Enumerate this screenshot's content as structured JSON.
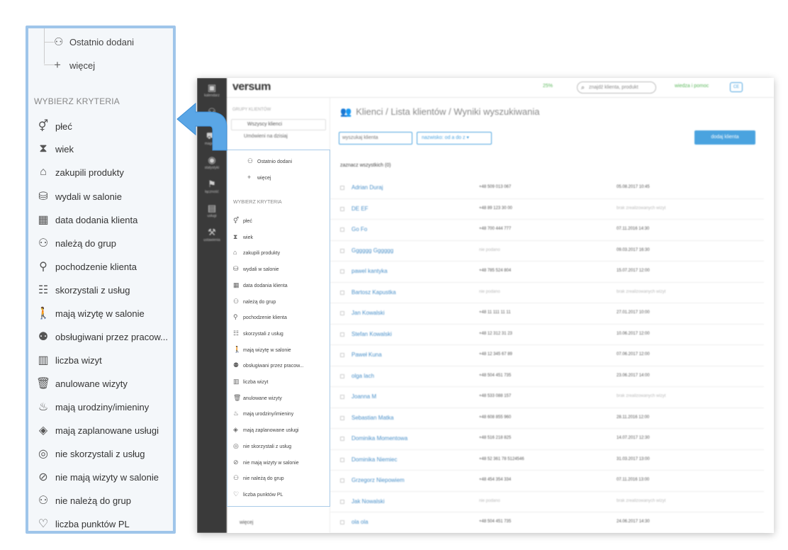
{
  "zoom_panel": {
    "recent_label": "Ostatnio dodani",
    "more_label": "więcej",
    "section_title": "WYBIERZ KRYTERIA",
    "criteria": [
      {
        "label": "płeć",
        "icon": "gender-icon"
      },
      {
        "label": "wiek",
        "icon": "hourglass-icon"
      },
      {
        "label": "zakupili produkty",
        "icon": "shopping-bag-icon"
      },
      {
        "label": "wydali w salonie",
        "icon": "coins-icon"
      },
      {
        "label": "data dodania klienta",
        "icon": "calendar-icon"
      },
      {
        "label": "należą do grup",
        "icon": "user-group-icon"
      },
      {
        "label": "pochodzenie klienta",
        "icon": "origin-icon"
      },
      {
        "label": "skorzystali z usług",
        "icon": "services-list-icon"
      },
      {
        "label": "mają wizytę w salonie",
        "icon": "walking-person-icon"
      },
      {
        "label": "obsługiwani przez pracow...",
        "icon": "employee-icon"
      },
      {
        "label": "liczba wizyt",
        "icon": "bar-chart-icon"
      },
      {
        "label": "anulowane wizyty",
        "icon": "trash-icon"
      },
      {
        "label": "mają urodziny/imieniny",
        "icon": "birthday-cake-icon"
      },
      {
        "label": "mają zaplanowane usługi",
        "icon": "ticket-icon"
      },
      {
        "label": "nie skorzystali z usług",
        "icon": "no-services-icon"
      },
      {
        "label": "nie mają wizyty w salonie",
        "icon": "prohibited-icon"
      },
      {
        "label": "nie należą do grup",
        "icon": "no-group-icon"
      },
      {
        "label": "liczba punktów PL",
        "icon": "heart-icon"
      }
    ]
  },
  "app": {
    "logo": "versum",
    "progress_label": "25%",
    "search_placeholder": "znajdź klienta, produkt",
    "help_label": "wiedza i pomoc",
    "user_label": "CE",
    "rail": [
      "kalendarz",
      "klienci",
      "magazyn",
      "statystyki",
      "łączność",
      "usługi",
      "ustawienia"
    ],
    "groups_title": "GRUPY KLIENTÓW",
    "all_clients": "Wszyscy klienci",
    "today_label": "Umówieni na dzisiaj",
    "recent_label": "Ostatnio dodani",
    "more_label": "więcej",
    "criteria_title": "WYBIERZ KRYTERIA",
    "bottom_more": "więcej",
    "breadcrumb": "Klienci / Lista klientów / Wyniki wyszukiwania",
    "search_client": "wyszukaj klienta",
    "sort_label": "nazwisko: od a do z ▾",
    "add_client": "dodaj klienta",
    "select_all": "zaznacz wszystkich (0)",
    "clients": [
      {
        "name": "Adrian Duraj",
        "phone": "+48 509 013 067",
        "visit": "05.08.2017 10:45"
      },
      {
        "name": "DE EF",
        "phone": "+48 89 123 30 00",
        "visit": "brak zrealizowanych wizyt"
      },
      {
        "name": "Go Fo",
        "phone": "+48 700 444 777",
        "visit": "07.11.2016 14:30"
      },
      {
        "name": "Gggggg Gggggg",
        "phone": "nie podano",
        "visit": "09.03.2017 16:30"
      },
      {
        "name": "pawel kantyka",
        "phone": "+48 785 524 804",
        "visit": "15.07.2017 12:00"
      },
      {
        "name": "Bartosz Kapustka",
        "phone": "nie podano",
        "visit": "brak zrealizowanych wizyt"
      },
      {
        "name": "Jan Kowalski",
        "phone": "+48 11 111 11 11",
        "visit": "27.01.2017 10:00"
      },
      {
        "name": "Stefan Kowalski",
        "phone": "+48 12 312 31 23",
        "visit": "10.06.2017 12:00"
      },
      {
        "name": "Paweł Kuna",
        "phone": "+48 12 345 67 89",
        "visit": "07.06.2017 12:00"
      },
      {
        "name": "olga lach",
        "phone": "+48 504 451 735",
        "visit": "23.06.2017 14:00"
      },
      {
        "name": "Joanna M",
        "phone": "+48 533 088 157",
        "visit": "brak zrealizowanych wizyt"
      },
      {
        "name": "Sebastian Matka",
        "phone": "+48 608 855 960",
        "visit": "28.11.2016 12:00"
      },
      {
        "name": "Dominika Momentowa",
        "phone": "+48 516 218 825",
        "visit": "14.07.2017 12:30"
      },
      {
        "name": "Dominika Niemiec",
        "phone": "+48 52 361 78 5124546",
        "visit": "31.03.2017 13:00"
      },
      {
        "name": "Grzegorz Niepowiem",
        "phone": "+48 454 354 334",
        "visit": "07.11.2016 13:00"
      },
      {
        "name": "Jak Nowalski",
        "phone": "nie podano",
        "visit": "brak zrealizowanych wizyt"
      },
      {
        "name": "ola ola",
        "phone": "+48 504 451 735",
        "visit": "24.06.2017 14:30"
      }
    ]
  },
  "colors": {
    "accent": "#4aa3df",
    "callout_border": "#9fc5ea",
    "link": "#4a90c9"
  }
}
